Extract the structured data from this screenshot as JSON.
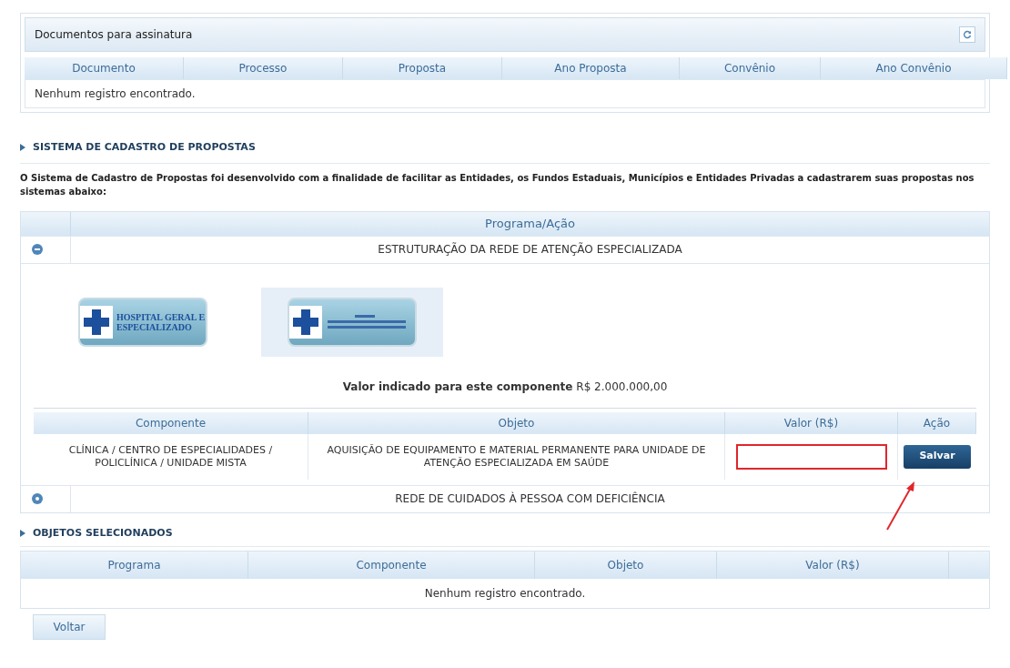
{
  "documents_panel": {
    "title": "Documentos para assinatura",
    "columns": [
      "Documento",
      "Processo",
      "Proposta",
      "Ano Proposta",
      "Convênio",
      "Ano Convênio"
    ],
    "empty_message": "Nenhum registro encontrado."
  },
  "system_section": {
    "title": "SISTEMA DE CADASTRO DE PROPOSTAS",
    "description": "O Sistema de Cadastro de Propostas foi desenvolvido com a finalidade de facilitar as Entidades, os Fundos Estaduais, Municípios e Entidades Privadas a cadastrarem suas propostas nos sistemas abaixo:"
  },
  "program_table": {
    "column": "Programa/Ação",
    "programs": [
      {
        "name": "ESTRUTURAÇÃO DA REDE DE ATENÇÃO ESPECIALIZADA",
        "expanded": true,
        "systems": [
          {
            "label": "HOSPITAL GERAL E ESPECIALIZADO",
            "selected": false
          },
          {
            "selected": true
          }
        ],
        "value_label": "Valor indicado para este componente",
        "value_amount": "R$ 2.000.000,00",
        "columns": [
          "Componente",
          "Objeto",
          "Valor (R$)",
          "Ação"
        ],
        "rows": [
          {
            "componente": "CLÍNICA / CENTRO DE ESPECIALIDADES / POLICLÍNICA / UNIDADE MISTA",
            "objeto": "AQUISIÇÃO DE EQUIPAMENTO E MATERIAL PERMANENTE PARA UNIDADE DE ATENÇÃO ESPECIALIZADA EM SAÚDE",
            "button": "Salvar"
          }
        ]
      },
      {
        "name": "REDE DE CUIDADOS À PESSOA COM DEFICIÊNCIA",
        "expanded": false
      }
    ]
  },
  "selected_objects": {
    "title": "OBJETOS SELECIONADOS",
    "columns": [
      "Programa",
      "Componente",
      "Objeto",
      "Valor (R$)"
    ],
    "empty_message": "Nenhum registro encontrado."
  },
  "back_button": "Voltar"
}
